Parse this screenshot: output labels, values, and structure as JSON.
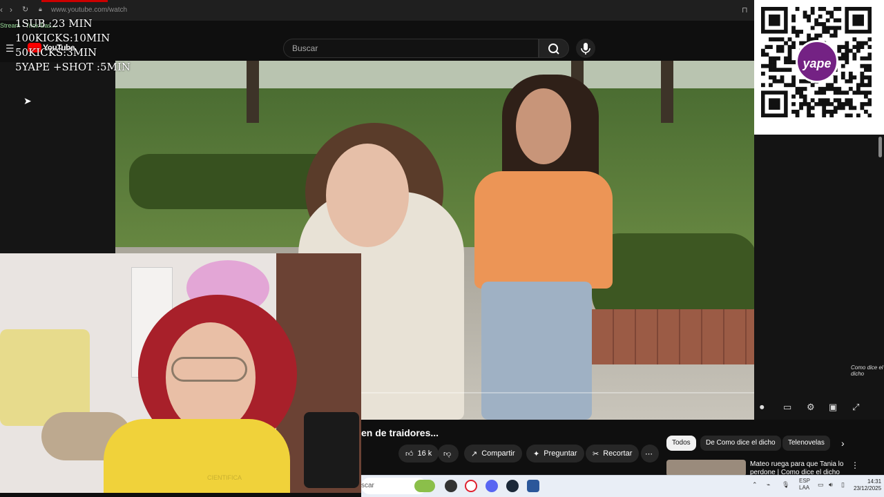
{
  "browser": {
    "url": "www.youtube.com/watch",
    "back_icon": "back-arrow-icon",
    "forward_icon": "forward-arrow-icon",
    "reload_icon": "reload-icon"
  },
  "youtube": {
    "logo_text": "YouTube",
    "search_placeholder": "Buscar",
    "video_title": "en de traidores...",
    "likes": "16 k",
    "share_label": "Compartir",
    "ask_label": "Preguntar",
    "clip_label": "Recortar",
    "chips": [
      "Todos",
      "De Como dice el dicho",
      "Telenovelas"
    ],
    "recommended_title": "Mateo ruega para que Tania lo perdone | Como dice el dicho",
    "watermark": "Como dice el dicho"
  },
  "overlay": {
    "streamer_tag": "Stream - Trick Bas...",
    "lines": [
      "1SUB :23 MIN",
      "100KICKS:10MIN",
      "50KICKS:3MIN",
      "5YAPE +SHOT :5MIN"
    ]
  },
  "qr": {
    "brand": "yape",
    "accent": "#742284"
  },
  "webcam": {
    "shirt_text": "CIENTIFICA"
  },
  "taskbar": {
    "search_text": "scar",
    "lang_top": "ESP",
    "lang_bottom": "LAA",
    "time": "14:31",
    "date": "23/12/2025"
  },
  "colors": {
    "youtube_red": "#ff0000",
    "background": "#0f0f0f",
    "pill": "#272727"
  }
}
